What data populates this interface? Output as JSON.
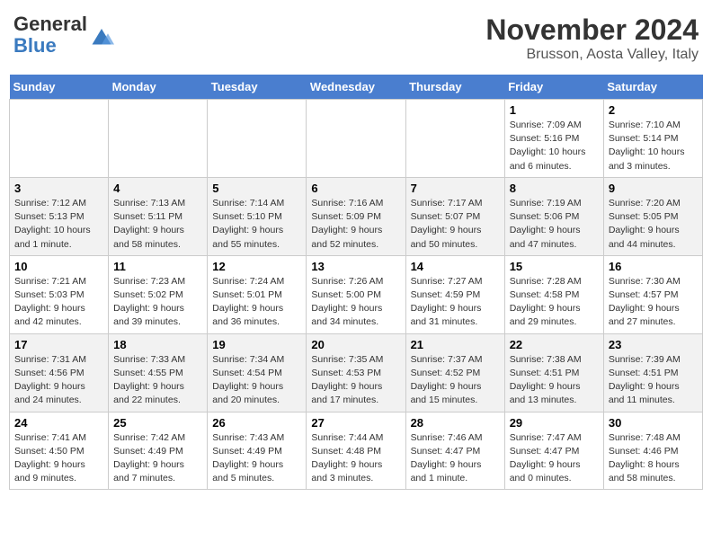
{
  "logo": {
    "general": "General",
    "blue": "Blue"
  },
  "header": {
    "title": "November 2024",
    "location": "Brusson, Aosta Valley, Italy"
  },
  "days_of_week": [
    "Sunday",
    "Monday",
    "Tuesday",
    "Wednesday",
    "Thursday",
    "Friday",
    "Saturday"
  ],
  "weeks": [
    [
      {
        "day": "",
        "info": ""
      },
      {
        "day": "",
        "info": ""
      },
      {
        "day": "",
        "info": ""
      },
      {
        "day": "",
        "info": ""
      },
      {
        "day": "",
        "info": ""
      },
      {
        "day": "1",
        "info": "Sunrise: 7:09 AM\nSunset: 5:16 PM\nDaylight: 10 hours and 6 minutes."
      },
      {
        "day": "2",
        "info": "Sunrise: 7:10 AM\nSunset: 5:14 PM\nDaylight: 10 hours and 3 minutes."
      }
    ],
    [
      {
        "day": "3",
        "info": "Sunrise: 7:12 AM\nSunset: 5:13 PM\nDaylight: 10 hours and 1 minute."
      },
      {
        "day": "4",
        "info": "Sunrise: 7:13 AM\nSunset: 5:11 PM\nDaylight: 9 hours and 58 minutes."
      },
      {
        "day": "5",
        "info": "Sunrise: 7:14 AM\nSunset: 5:10 PM\nDaylight: 9 hours and 55 minutes."
      },
      {
        "day": "6",
        "info": "Sunrise: 7:16 AM\nSunset: 5:09 PM\nDaylight: 9 hours and 52 minutes."
      },
      {
        "day": "7",
        "info": "Sunrise: 7:17 AM\nSunset: 5:07 PM\nDaylight: 9 hours and 50 minutes."
      },
      {
        "day": "8",
        "info": "Sunrise: 7:19 AM\nSunset: 5:06 PM\nDaylight: 9 hours and 47 minutes."
      },
      {
        "day": "9",
        "info": "Sunrise: 7:20 AM\nSunset: 5:05 PM\nDaylight: 9 hours and 44 minutes."
      }
    ],
    [
      {
        "day": "10",
        "info": "Sunrise: 7:21 AM\nSunset: 5:03 PM\nDaylight: 9 hours and 42 minutes."
      },
      {
        "day": "11",
        "info": "Sunrise: 7:23 AM\nSunset: 5:02 PM\nDaylight: 9 hours and 39 minutes."
      },
      {
        "day": "12",
        "info": "Sunrise: 7:24 AM\nSunset: 5:01 PM\nDaylight: 9 hours and 36 minutes."
      },
      {
        "day": "13",
        "info": "Sunrise: 7:26 AM\nSunset: 5:00 PM\nDaylight: 9 hours and 34 minutes."
      },
      {
        "day": "14",
        "info": "Sunrise: 7:27 AM\nSunset: 4:59 PM\nDaylight: 9 hours and 31 minutes."
      },
      {
        "day": "15",
        "info": "Sunrise: 7:28 AM\nSunset: 4:58 PM\nDaylight: 9 hours and 29 minutes."
      },
      {
        "day": "16",
        "info": "Sunrise: 7:30 AM\nSunset: 4:57 PM\nDaylight: 9 hours and 27 minutes."
      }
    ],
    [
      {
        "day": "17",
        "info": "Sunrise: 7:31 AM\nSunset: 4:56 PM\nDaylight: 9 hours and 24 minutes."
      },
      {
        "day": "18",
        "info": "Sunrise: 7:33 AM\nSunset: 4:55 PM\nDaylight: 9 hours and 22 minutes."
      },
      {
        "day": "19",
        "info": "Sunrise: 7:34 AM\nSunset: 4:54 PM\nDaylight: 9 hours and 20 minutes."
      },
      {
        "day": "20",
        "info": "Sunrise: 7:35 AM\nSunset: 4:53 PM\nDaylight: 9 hours and 17 minutes."
      },
      {
        "day": "21",
        "info": "Sunrise: 7:37 AM\nSunset: 4:52 PM\nDaylight: 9 hours and 15 minutes."
      },
      {
        "day": "22",
        "info": "Sunrise: 7:38 AM\nSunset: 4:51 PM\nDaylight: 9 hours and 13 minutes."
      },
      {
        "day": "23",
        "info": "Sunrise: 7:39 AM\nSunset: 4:51 PM\nDaylight: 9 hours and 11 minutes."
      }
    ],
    [
      {
        "day": "24",
        "info": "Sunrise: 7:41 AM\nSunset: 4:50 PM\nDaylight: 9 hours and 9 minutes."
      },
      {
        "day": "25",
        "info": "Sunrise: 7:42 AM\nSunset: 4:49 PM\nDaylight: 9 hours and 7 minutes."
      },
      {
        "day": "26",
        "info": "Sunrise: 7:43 AM\nSunset: 4:49 PM\nDaylight: 9 hours and 5 minutes."
      },
      {
        "day": "27",
        "info": "Sunrise: 7:44 AM\nSunset: 4:48 PM\nDaylight: 9 hours and 3 minutes."
      },
      {
        "day": "28",
        "info": "Sunrise: 7:46 AM\nSunset: 4:47 PM\nDaylight: 9 hours and 1 minute."
      },
      {
        "day": "29",
        "info": "Sunrise: 7:47 AM\nSunset: 4:47 PM\nDaylight: 9 hours and 0 minutes."
      },
      {
        "day": "30",
        "info": "Sunrise: 7:48 AM\nSunset: 4:46 PM\nDaylight: 8 hours and 58 minutes."
      }
    ]
  ]
}
